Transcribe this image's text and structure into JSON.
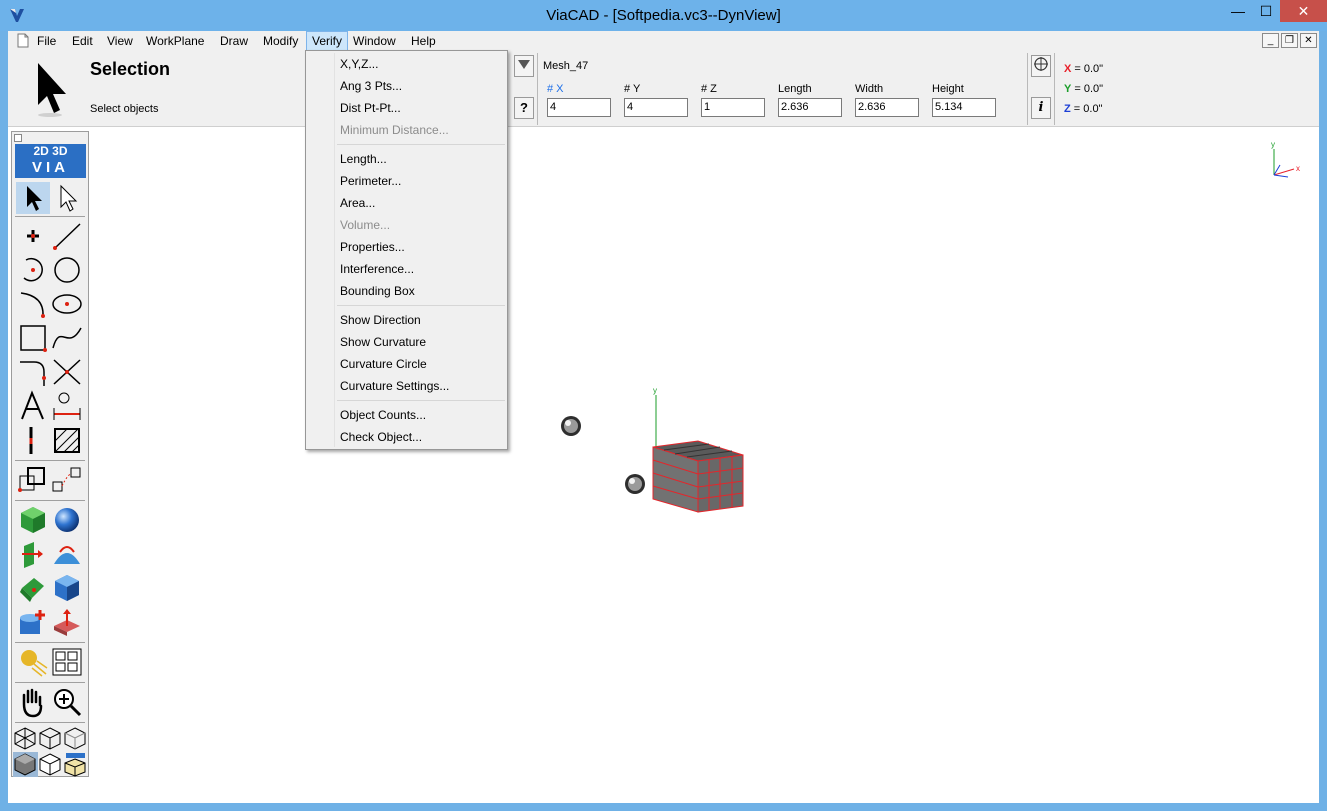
{
  "window": {
    "title": "ViaCAD - [Softpedia.vc3--DynView]",
    "min_label": "—",
    "max_label": "☐",
    "close_label": "✕"
  },
  "menubar": {
    "items": [
      "File",
      "Edit",
      "View",
      "WorkPlane",
      "Draw",
      "Modify",
      "Verify",
      "Window",
      "Help"
    ],
    "active": "Verify",
    "mdi": {
      "min": "_",
      "restore": "❐",
      "close": "✕"
    }
  },
  "toolbar": {
    "title": "Selection",
    "subtitle": "Select objects",
    "object_name": "Mesh_47",
    "help_label": "?",
    "info_label": "i",
    "fields": [
      {
        "label": "# X",
        "value": "4"
      },
      {
        "label": "# Y",
        "value": "4"
      },
      {
        "label": "# Z",
        "value": "1"
      },
      {
        "label": "Length",
        "value": "2.636"
      },
      {
        "label": "Width",
        "value": "2.636"
      },
      {
        "label": "Height",
        "value": "5.134"
      }
    ],
    "coords": [
      {
        "axis": "X",
        "value": " = 0.0\"",
        "color": "#e8202a"
      },
      {
        "axis": "Y",
        "value": " = 0.0\"",
        "color": "#1b9e2a"
      },
      {
        "axis": "Z",
        "value": " = 0.0\"",
        "color": "#1c3fd6"
      }
    ]
  },
  "verify_menu": {
    "items": [
      {
        "label": "X,Y,Z...",
        "enabled": true
      },
      {
        "label": "Ang 3 Pts...",
        "enabled": true
      },
      {
        "label": "Dist Pt-Pt...",
        "enabled": true
      },
      {
        "label": "Minimum Distance...",
        "enabled": false
      },
      {
        "label": "Length...",
        "enabled": true
      },
      {
        "label": "Perimeter...",
        "enabled": true
      },
      {
        "label": "Area...",
        "enabled": true
      },
      {
        "label": "Volume...",
        "enabled": false
      },
      {
        "label": "Properties...",
        "enabled": true
      },
      {
        "label": "Interference...",
        "enabled": true
      },
      {
        "label": "Bounding Box",
        "enabled": true
      },
      {
        "label": "Show Direction",
        "enabled": true
      },
      {
        "label": "Show Curvature",
        "enabled": true
      },
      {
        "label": "Curvature Circle",
        "enabled": true
      },
      {
        "label": "Curvature Settings...",
        "enabled": true
      },
      {
        "label": "Object Counts...",
        "enabled": true
      },
      {
        "label": "Check Object...",
        "enabled": true
      }
    ]
  },
  "palette": {
    "logo_top": "2D 3D",
    "logo_bottom": "VIA"
  },
  "viewport": {
    "triad_x": "x",
    "triad_y": "y",
    "object_axis": "y"
  },
  "colors": {
    "accent": "#6db2ea",
    "menu_highlight": "#cde6fb",
    "mesh_edge": "#e3262b",
    "mesh_face": "#6e6e6e"
  }
}
